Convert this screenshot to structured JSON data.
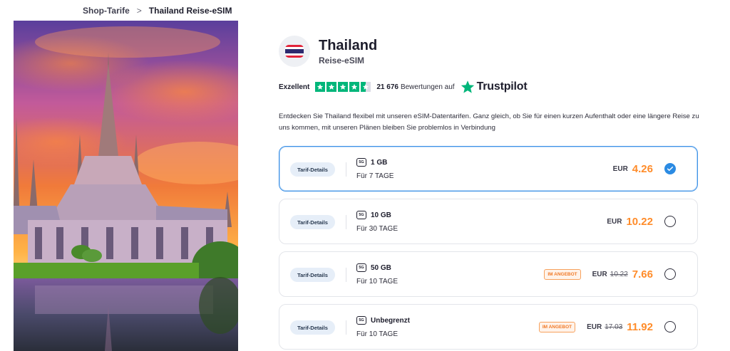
{
  "breadcrumb": {
    "parent": "Shop-Tarife",
    "separator": ">",
    "current": "Thailand Reise-eSIM"
  },
  "product": {
    "title": "Thailand",
    "subtitle": "Reise-eSIM",
    "flag_icon": "thailand-flag-icon"
  },
  "trustpilot": {
    "rating_word": "Exzellent",
    "stars": 4.5,
    "review_count": "21 676",
    "count_suffix": "Bewertungen auf",
    "brand": "Trustpilot",
    "color": "#00b67a"
  },
  "description": "Entdecken Sie Thailand flexibel mit unseren eSIM-Datentarifen. Ganz gleich, ob Sie für einen kurzen Aufenthalt oder eine längere Reise zu uns kommen, mit unseren Plänen bleiben Sie problemlos in Verbindung",
  "plans": [
    {
      "details_label": "Tarif-Details",
      "network_badge": "5G",
      "volume": "1 GB",
      "duration": "Für 7 TAGE",
      "currency": "EUR",
      "price": "4.26",
      "selected": true
    },
    {
      "details_label": "Tarif-Details",
      "network_badge": "5G",
      "volume": "10 GB",
      "duration": "Für 30 TAGE",
      "currency": "EUR",
      "price": "10.22",
      "selected": false
    },
    {
      "details_label": "Tarif-Details",
      "network_badge": "5G",
      "volume": "50 GB",
      "duration": "Für 10 TAGE",
      "offer_badge": "IM ANGEBOT",
      "currency": "EUR",
      "old_price": "10.22",
      "price": "7.66",
      "selected": false
    },
    {
      "details_label": "Tarif-Details",
      "network_badge": "5G",
      "volume": "Unbegrenzt",
      "duration": "Für 10 TAGE",
      "offer_badge": "IM ANGEBOT",
      "currency": "EUR",
      "old_price": "17.03",
      "price": "11.92",
      "selected": false
    }
  ],
  "colors": {
    "accent_price": "#ff8c2a",
    "selected_border": "#3d91e6",
    "radio_checked": "#2b8be3"
  }
}
